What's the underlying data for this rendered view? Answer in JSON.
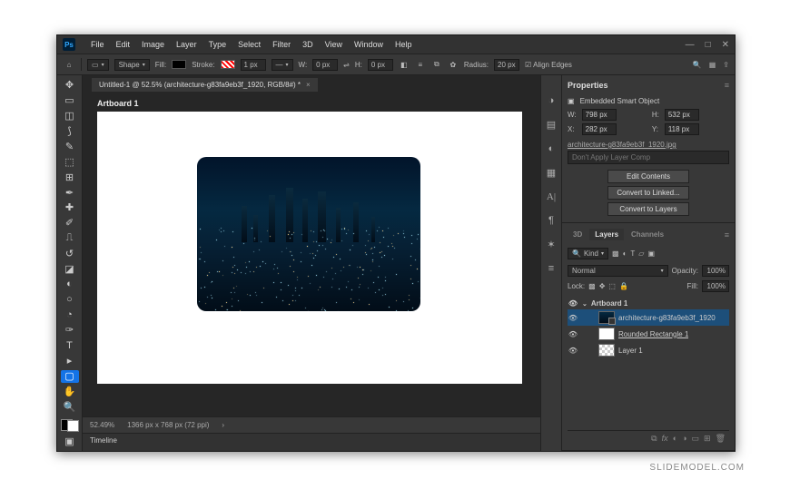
{
  "menubar": [
    "File",
    "Edit",
    "Image",
    "Layer",
    "Type",
    "Select",
    "Filter",
    "3D",
    "View",
    "Window",
    "Help"
  ],
  "options": {
    "shape_mode": "Shape",
    "fill_label": "Fill:",
    "stroke_label": "Stroke:",
    "stroke_width": "1 px",
    "w_label": "W:",
    "w_value": "0 px",
    "h_label": "H:",
    "h_value": "0 px",
    "radius_label": "Radius:",
    "radius_value": "20 px",
    "align_edges": "Align Edges"
  },
  "document": {
    "tab_title": "Untitled-1 @ 52.5% (architecture-g83fa9eb3f_1920, RGB/8#) *",
    "artboard_name": "Artboard 1",
    "zoom": "52.49%",
    "dims": "1366 px x 768 px (72 ppi)"
  },
  "timeline_label": "Timeline",
  "properties": {
    "panel_title": "Properties",
    "type_label": "Embedded Smart Object",
    "w_label": "W:",
    "w_value": "798 px",
    "h_label": "H:",
    "h_value": "532 px",
    "x_label": "X:",
    "x_value": "282 px",
    "y_label": "Y:",
    "y_value": "118 px",
    "filename": "architecture-g83fa9eb3f_1920.jpg",
    "layer_comp": "Don't Apply Layer Comp",
    "btn_edit": "Edit Contents",
    "btn_linked": "Convert to Linked...",
    "btn_layers": "Convert to Layers"
  },
  "layers": {
    "tabs": [
      "3D",
      "Layers",
      "Channels"
    ],
    "kind_label": "Kind",
    "blend_mode": "Normal",
    "opacity_label": "Opacity:",
    "opacity_value": "100%",
    "lock_label": "Lock:",
    "fill_label": "Fill:",
    "fill_value": "100%",
    "artboard": "Artboard 1",
    "items": [
      {
        "name": "architecture-g83fa9eb3f_1920",
        "selected": true,
        "thumb": "so"
      },
      {
        "name": "Rounded Rectangle 1",
        "selected": false,
        "thumb": "white",
        "underline": true
      },
      {
        "name": "Layer 1",
        "selected": false,
        "thumb": "checker"
      }
    ]
  },
  "watermark": "SLIDEMODEL.COM"
}
